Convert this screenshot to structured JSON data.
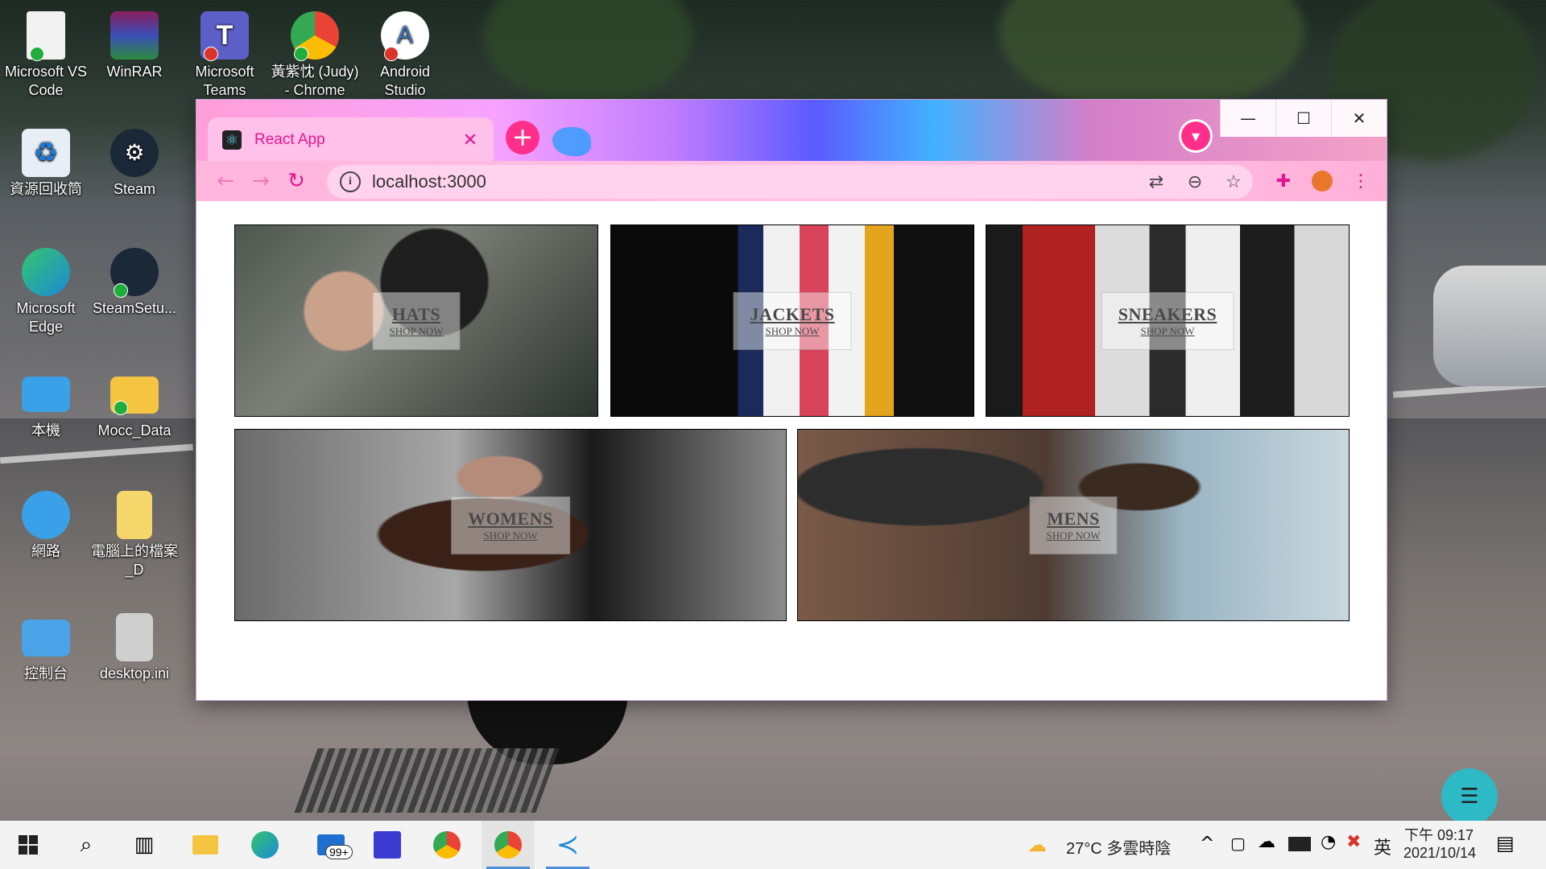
{
  "desktop": {
    "icons": [
      {
        "label": "Microsoft VS Code"
      },
      {
        "label": "WinRAR"
      },
      {
        "label": "Microsoft Teams"
      },
      {
        "label": "黃紫忱 (Judy) - Chrome"
      },
      {
        "label": "Android Studio"
      },
      {
        "label": "資源回收筒"
      },
      {
        "label": "Steam"
      },
      {
        "label": "Microsoft Edge"
      },
      {
        "label": "SteamSetu..."
      },
      {
        "label": "本機"
      },
      {
        "label": "Mocc_Data"
      },
      {
        "label": "網路"
      },
      {
        "label": "電腦上的檔案_D"
      },
      {
        "label": "控制台"
      },
      {
        "label": "desktop.ini"
      }
    ]
  },
  "browser": {
    "tab": {
      "title": "React App",
      "close": "✕"
    },
    "new_tab": "+",
    "url": "localhost:3000",
    "window_controls": {
      "minimize": "—",
      "maximize": "☐",
      "close": "✕"
    }
  },
  "page": {
    "cards": [
      {
        "title": "HATS",
        "subtitle": "SHOP NOW"
      },
      {
        "title": "JACKETS",
        "subtitle": "SHOP NOW"
      },
      {
        "title": "SNEAKERS",
        "subtitle": "SHOP NOW"
      },
      {
        "title": "WOMENS",
        "subtitle": "SHOP NOW"
      },
      {
        "title": "MENS",
        "subtitle": "SHOP NOW"
      }
    ]
  },
  "taskbar": {
    "mail_badge": "99+",
    "weather": "27°C  多雲時陰",
    "ime": "英",
    "time": "下午 09:17",
    "date": "2021/10/14"
  }
}
